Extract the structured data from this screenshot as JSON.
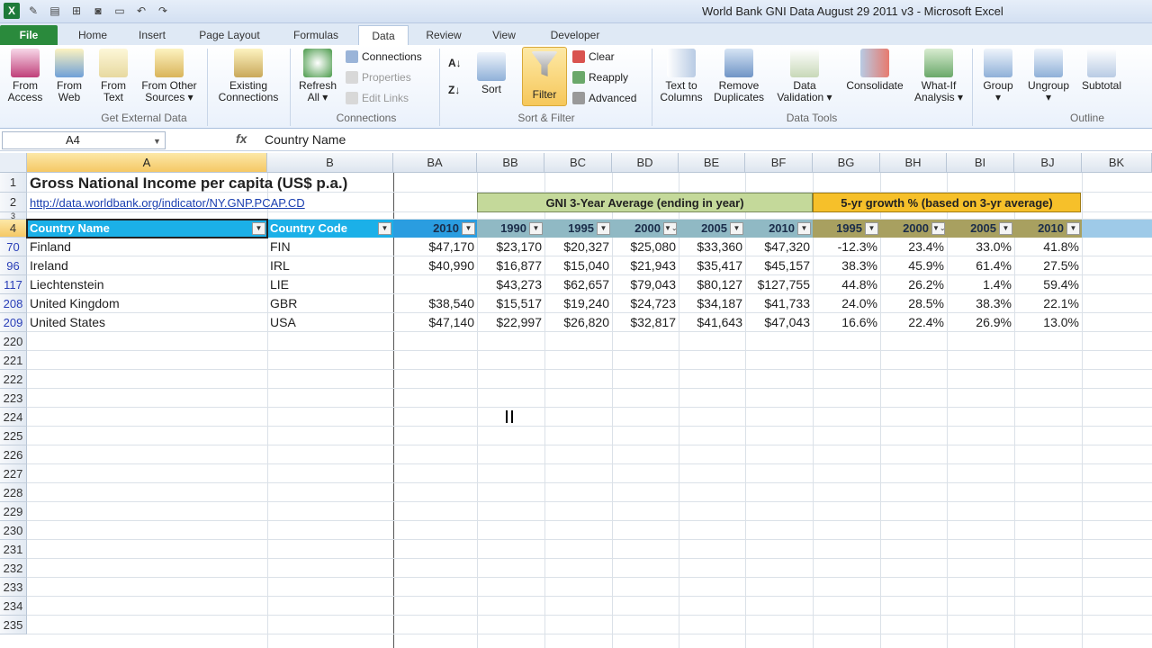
{
  "window": {
    "title": "World Bank GNI Data August 29 2011 v3  -  Microsoft Excel"
  },
  "tabs": [
    "File",
    "Home",
    "Insert",
    "Page Layout",
    "Formulas",
    "Data",
    "Review",
    "View",
    "Developer"
  ],
  "ribbon": {
    "from_access": [
      "From",
      "Access"
    ],
    "from_web": [
      "From",
      "Web"
    ],
    "from_text": [
      "From",
      "Text"
    ],
    "from_other": [
      "From Other",
      "Sources ▾"
    ],
    "existing": [
      "Existing",
      "Connections"
    ],
    "group_external": "Get External Data",
    "refresh": [
      "Refresh",
      "All ▾"
    ],
    "connections": "Connections",
    "properties": "Properties",
    "edit_links": "Edit Links",
    "group_connections": "Connections",
    "sort": "Sort",
    "filter": "Filter",
    "clear": "Clear",
    "reapply": "Reapply",
    "advanced": "Advanced",
    "group_sort": "Sort & Filter",
    "text_to_columns": [
      "Text to",
      "Columns"
    ],
    "remove_dup": [
      "Remove",
      "Duplicates"
    ],
    "data_validation": [
      "Data",
      "Validation ▾"
    ],
    "consolidate": "Consolidate",
    "whatif": [
      "What-If",
      "Analysis ▾"
    ],
    "group_tools": "Data Tools",
    "group": [
      "Group",
      "▾"
    ],
    "ungroup": [
      "Ungroup",
      "▾"
    ],
    "subtotal": "Subtotal",
    "group_outline": "Outline"
  },
  "formula_bar": {
    "name": "A4",
    "fx": "fx",
    "content": "Country Name"
  },
  "columns": [
    "A",
    "B",
    "BA",
    "BB",
    "BC",
    "BD",
    "BE",
    "BF",
    "BG",
    "BH",
    "BI",
    "BJ",
    "BK"
  ],
  "sheet": {
    "title": "Gross National Income per capita (US$ p.a.)",
    "link": "http://data.worldbank.org/indicator/NY.GNP.PCAP.CD",
    "gni_header": "GNI 3-Year Average (ending in year)",
    "growth_header": "5-yr growth % (based on 3-yr average)",
    "headers": [
      "Country Name",
      "Country Code",
      "2010",
      "1990",
      "1995",
      "2000",
      "2005",
      "2010",
      "1995",
      "2000",
      "2005",
      "2010"
    ],
    "rows": [
      {
        "rownum": "70",
        "cells": [
          "Finland",
          "FIN",
          "$47,170",
          "$23,170",
          "$20,327",
          "$25,080",
          "$33,360",
          "$47,320",
          "-12.3%",
          "23.4%",
          "33.0%",
          "41.8%"
        ]
      },
      {
        "rownum": "96",
        "cells": [
          "Ireland",
          "IRL",
          "$40,990",
          "$16,877",
          "$15,040",
          "$21,943",
          "$35,417",
          "$45,157",
          "38.3%",
          "45.9%",
          "61.4%",
          "27.5%"
        ]
      },
      {
        "rownum": "117",
        "cells": [
          "Liechtenstein",
          "LIE",
          "",
          "$43,273",
          "$62,657",
          "$79,043",
          "$80,127",
          "$127,755",
          "44.8%",
          "26.2%",
          "1.4%",
          "59.4%"
        ]
      },
      {
        "rownum": "208",
        "cells": [
          "United Kingdom",
          "GBR",
          "$38,540",
          "$15,517",
          "$19,240",
          "$24,723",
          "$34,187",
          "$41,733",
          "24.0%",
          "28.5%",
          "38.3%",
          "22.1%"
        ]
      },
      {
        "rownum": "209",
        "cells": [
          "United States",
          "USA",
          "$47,140",
          "$22,997",
          "$26,820",
          "$32,817",
          "$41,643",
          "$47,043",
          "16.6%",
          "22.4%",
          "26.9%",
          "13.0%"
        ]
      }
    ],
    "top_rows": [
      "1",
      "2",
      "3",
      "4"
    ],
    "empty_rows": [
      "220",
      "221",
      "222",
      "223",
      "224",
      "225",
      "226",
      "227",
      "228",
      "229",
      "230",
      "231",
      "232",
      "233",
      "234",
      "235"
    ]
  }
}
